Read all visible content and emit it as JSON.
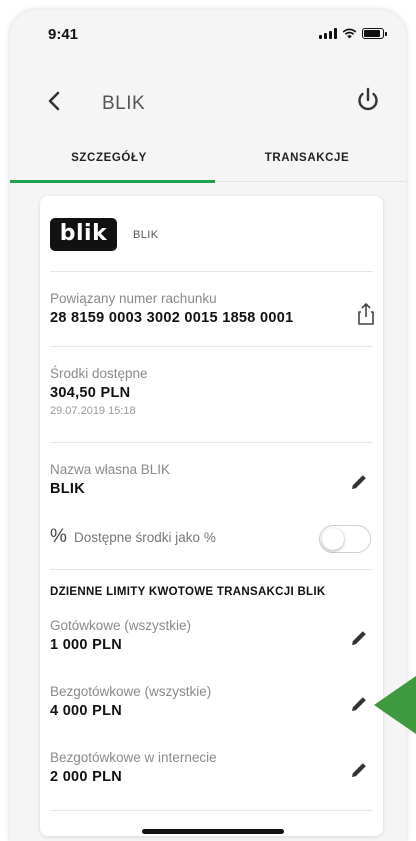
{
  "status_bar": {
    "time": "9:41"
  },
  "header": {
    "title": "BLIK"
  },
  "tabs": [
    {
      "label": "SZCZEGÓŁY",
      "active": true
    },
    {
      "label": "TRANSAKCJE",
      "active": false
    }
  ],
  "card": {
    "logo_text": "blik",
    "name": "BLIK",
    "account": {
      "label": "Powiązany numer rachunku",
      "value": "28 8159 0003 3002 0015 1858 0001"
    },
    "funds": {
      "label": "Środki dostępne",
      "value": "304,50 PLN",
      "timestamp": "29.07.2019 15:18"
    },
    "custom_name": {
      "label": "Nazwa własna BLIK",
      "value": "BLIK"
    },
    "percent_option": {
      "symbol": "%",
      "label": "Dostępne środki jako %",
      "enabled": false
    },
    "limits": {
      "header": "DZIENNE LIMITY KWOTOWE TRANSAKCJI BLIK",
      "items": [
        {
          "label": "Gotówkowe (wszystkie)",
          "value": "1 000 PLN"
        },
        {
          "label": "Bezgotówkowe (wszystkie)",
          "value": "4 000 PLN"
        },
        {
          "label": "Bezgotówkowe w internecie",
          "value": "2 000 PLN"
        }
      ]
    }
  },
  "icons": {
    "back": "chevron-left-icon",
    "power": "power-icon",
    "share": "share-icon",
    "edit": "pencil-icon"
  },
  "colors": {
    "accent": "#1ea34a",
    "arrow": "#3d9a3f",
    "logo_background": "#111111"
  }
}
